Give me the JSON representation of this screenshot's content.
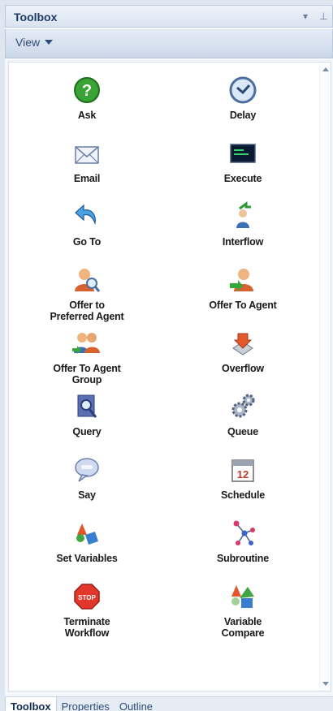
{
  "panel": {
    "title": "Toolbox",
    "pin_symbol": "▾",
    "dock_symbol": "⊥",
    "view_label": "View"
  },
  "tools": [
    {
      "label": "Ask",
      "icon": "question-icon"
    },
    {
      "label": "Delay",
      "icon": "clock-icon"
    },
    {
      "label": "Email",
      "icon": "envelope-icon"
    },
    {
      "label": "Execute",
      "icon": "console-icon"
    },
    {
      "label": "Go To",
      "icon": "arrow-back-icon"
    },
    {
      "label": "Interflow",
      "icon": "person-arrow-icon"
    },
    {
      "label": "Offer to\nPreferred Agent",
      "icon": "person-magnify-icon"
    },
    {
      "label": "Offer To Agent",
      "icon": "person-green-arrow-icon"
    },
    {
      "label": "Offer To Agent\nGroup",
      "icon": "people-icon"
    },
    {
      "label": "Overflow",
      "icon": "overflow-icon"
    },
    {
      "label": "Query",
      "icon": "database-magnify-icon"
    },
    {
      "label": "Queue",
      "icon": "gears-icon"
    },
    {
      "label": "Say",
      "icon": "speech-bubble-icon"
    },
    {
      "label": "Schedule",
      "icon": "calendar-icon"
    },
    {
      "label": "Set Variables",
      "icon": "shapes-icon"
    },
    {
      "label": "Subroutine",
      "icon": "network-nodes-icon"
    },
    {
      "label": "Terminate\nWorkflow",
      "icon": "stop-sign-icon"
    },
    {
      "label": "Variable\nCompare",
      "icon": "shapes-compare-icon"
    }
  ],
  "calendar_day": "12",
  "stop_text": "STOP",
  "bottom_tabs": [
    {
      "label": "Toolbox",
      "active": true
    },
    {
      "label": "Properties",
      "active": false
    },
    {
      "label": "Outline",
      "active": false
    }
  ]
}
